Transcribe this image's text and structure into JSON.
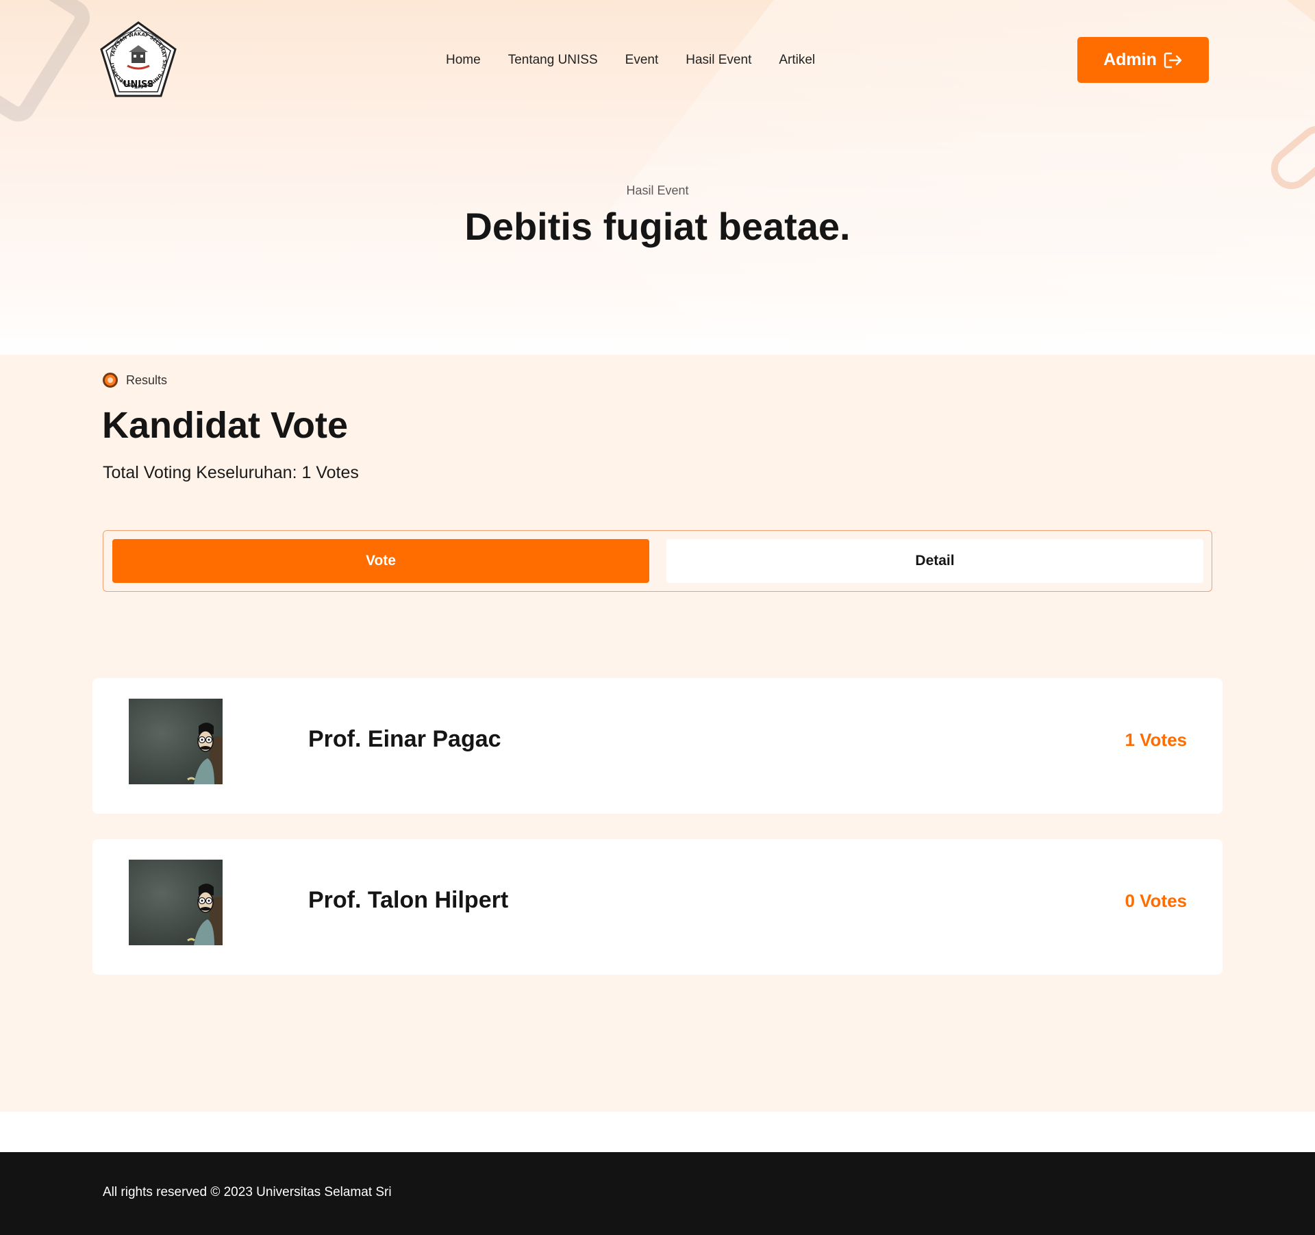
{
  "header": {
    "logo": {
      "alt": "Universitas Selamat Sri",
      "ring_text": "YAYASAN WAKAF SELAMAT SRI · UNIVERSITAS SELAMAT SRI",
      "abbr": "UNISS"
    },
    "nav": [
      "Home",
      "Tentang UNISS",
      "Event",
      "Hasil Event",
      "Artikel"
    ],
    "admin_label": "Admin",
    "admin_icon": "logout-arrow-icon"
  },
  "hero": {
    "subtitle": "Hasil Event",
    "title": "Debitis fugiat beatae."
  },
  "results": {
    "tag": "Results",
    "title": "Kandidat Vote",
    "total": "Total Voting Keseluruhan: 1 Votes"
  },
  "tabs": {
    "vote_label": "Vote",
    "detail_label": "Detail",
    "active": "vote"
  },
  "candidates": [
    {
      "name": "Prof. Einar Pagac",
      "votes": "1 Votes"
    },
    {
      "name": "Prof. Talon Hilpert",
      "votes": "0 Votes"
    }
  ],
  "footer": {
    "copyright": "All rights reserved © 2023 Universitas Selamat Sri"
  },
  "colors": {
    "accent": "#ff6d00",
    "footer_bg": "#131313",
    "section_bg": "#fff3ea"
  }
}
